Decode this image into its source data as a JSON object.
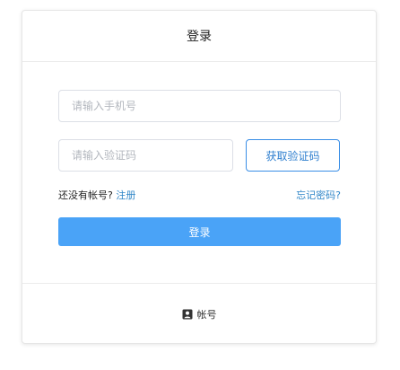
{
  "header": {
    "title": "登录"
  },
  "form": {
    "phone_placeholder": "请输入手机号",
    "code_placeholder": "请输入验证码",
    "get_code_label": "获取验证码",
    "no_account_text": "还没有帐号?",
    "register_label": "注册",
    "forgot_password_label": "忘记密码?",
    "login_label": "登录"
  },
  "footer": {
    "account_label": "帐号",
    "account_icon": "account-icon"
  },
  "colors": {
    "primary": "#4aa3f7",
    "link": "#2f86c8",
    "border": "#dcdfe6"
  }
}
